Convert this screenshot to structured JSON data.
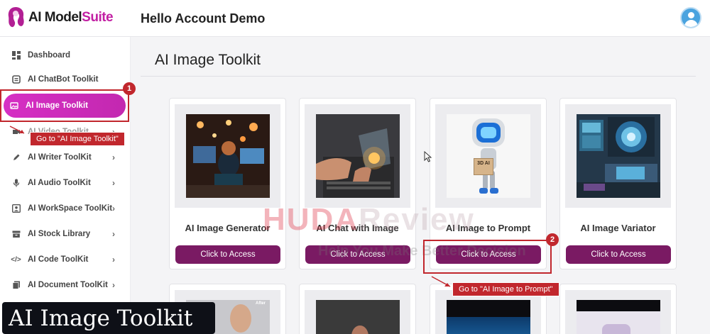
{
  "app": {
    "logo_part1": "AI Model",
    "logo_part2": "Suite",
    "greeting": "Hello Account Demo"
  },
  "sidebar": {
    "items": [
      {
        "label": "Dashboard",
        "icon": "dashboard-icon",
        "chevron": false
      },
      {
        "label": "AI ChatBot Toolkit",
        "icon": "chatbot-icon",
        "chevron": false
      },
      {
        "label": "AI Image Toolkit",
        "icon": "image-icon",
        "chevron": false,
        "active": true
      },
      {
        "label": "AI Video Toolkit",
        "icon": "video-icon",
        "chevron": true
      },
      {
        "label": "AI Writer ToolKit",
        "icon": "pen-icon",
        "chevron": true
      },
      {
        "label": "AI Audio ToolKit",
        "icon": "microphone-icon",
        "chevron": true
      },
      {
        "label": "AI WorkSpace ToolKit",
        "icon": "workspace-icon",
        "chevron": true
      },
      {
        "label": "AI Stock Library",
        "icon": "library-icon",
        "chevron": true
      },
      {
        "label": "AI Code ToolKit",
        "icon": "code-icon",
        "chevron": true
      },
      {
        "label": "AI Document ToolKit",
        "icon": "document-icon",
        "chevron": true
      }
    ]
  },
  "main": {
    "title": "AI Image Toolkit",
    "cards": [
      {
        "title": "AI Image Generator",
        "button": "Click to Access"
      },
      {
        "title": "AI Chat with Image",
        "button": "Click to Access"
      },
      {
        "title": "AI Image to Prompt",
        "button": "Click to Access",
        "thumb_text": "3D AI"
      },
      {
        "title": "AI Image Variator",
        "button": "Click to Access"
      }
    ],
    "second_row_labels": [
      "After"
    ]
  },
  "annotations": {
    "step1_number": "1",
    "step1_text": "Go to \"AI Image Toolkit\"",
    "step2_number": "2",
    "step2_text": "Go to \"AI Image to Prompt\""
  },
  "watermark": {
    "part1": "HUDA",
    "part2": "Review",
    "tagline": "Help You Make Better Decision"
  },
  "video_overlay": {
    "title": "AI Image Toolkit"
  },
  "colors": {
    "brand": "#c21fa3",
    "active_nav": "#d62fc4",
    "button": "#7a1a63",
    "annotation": "#c1272d"
  }
}
